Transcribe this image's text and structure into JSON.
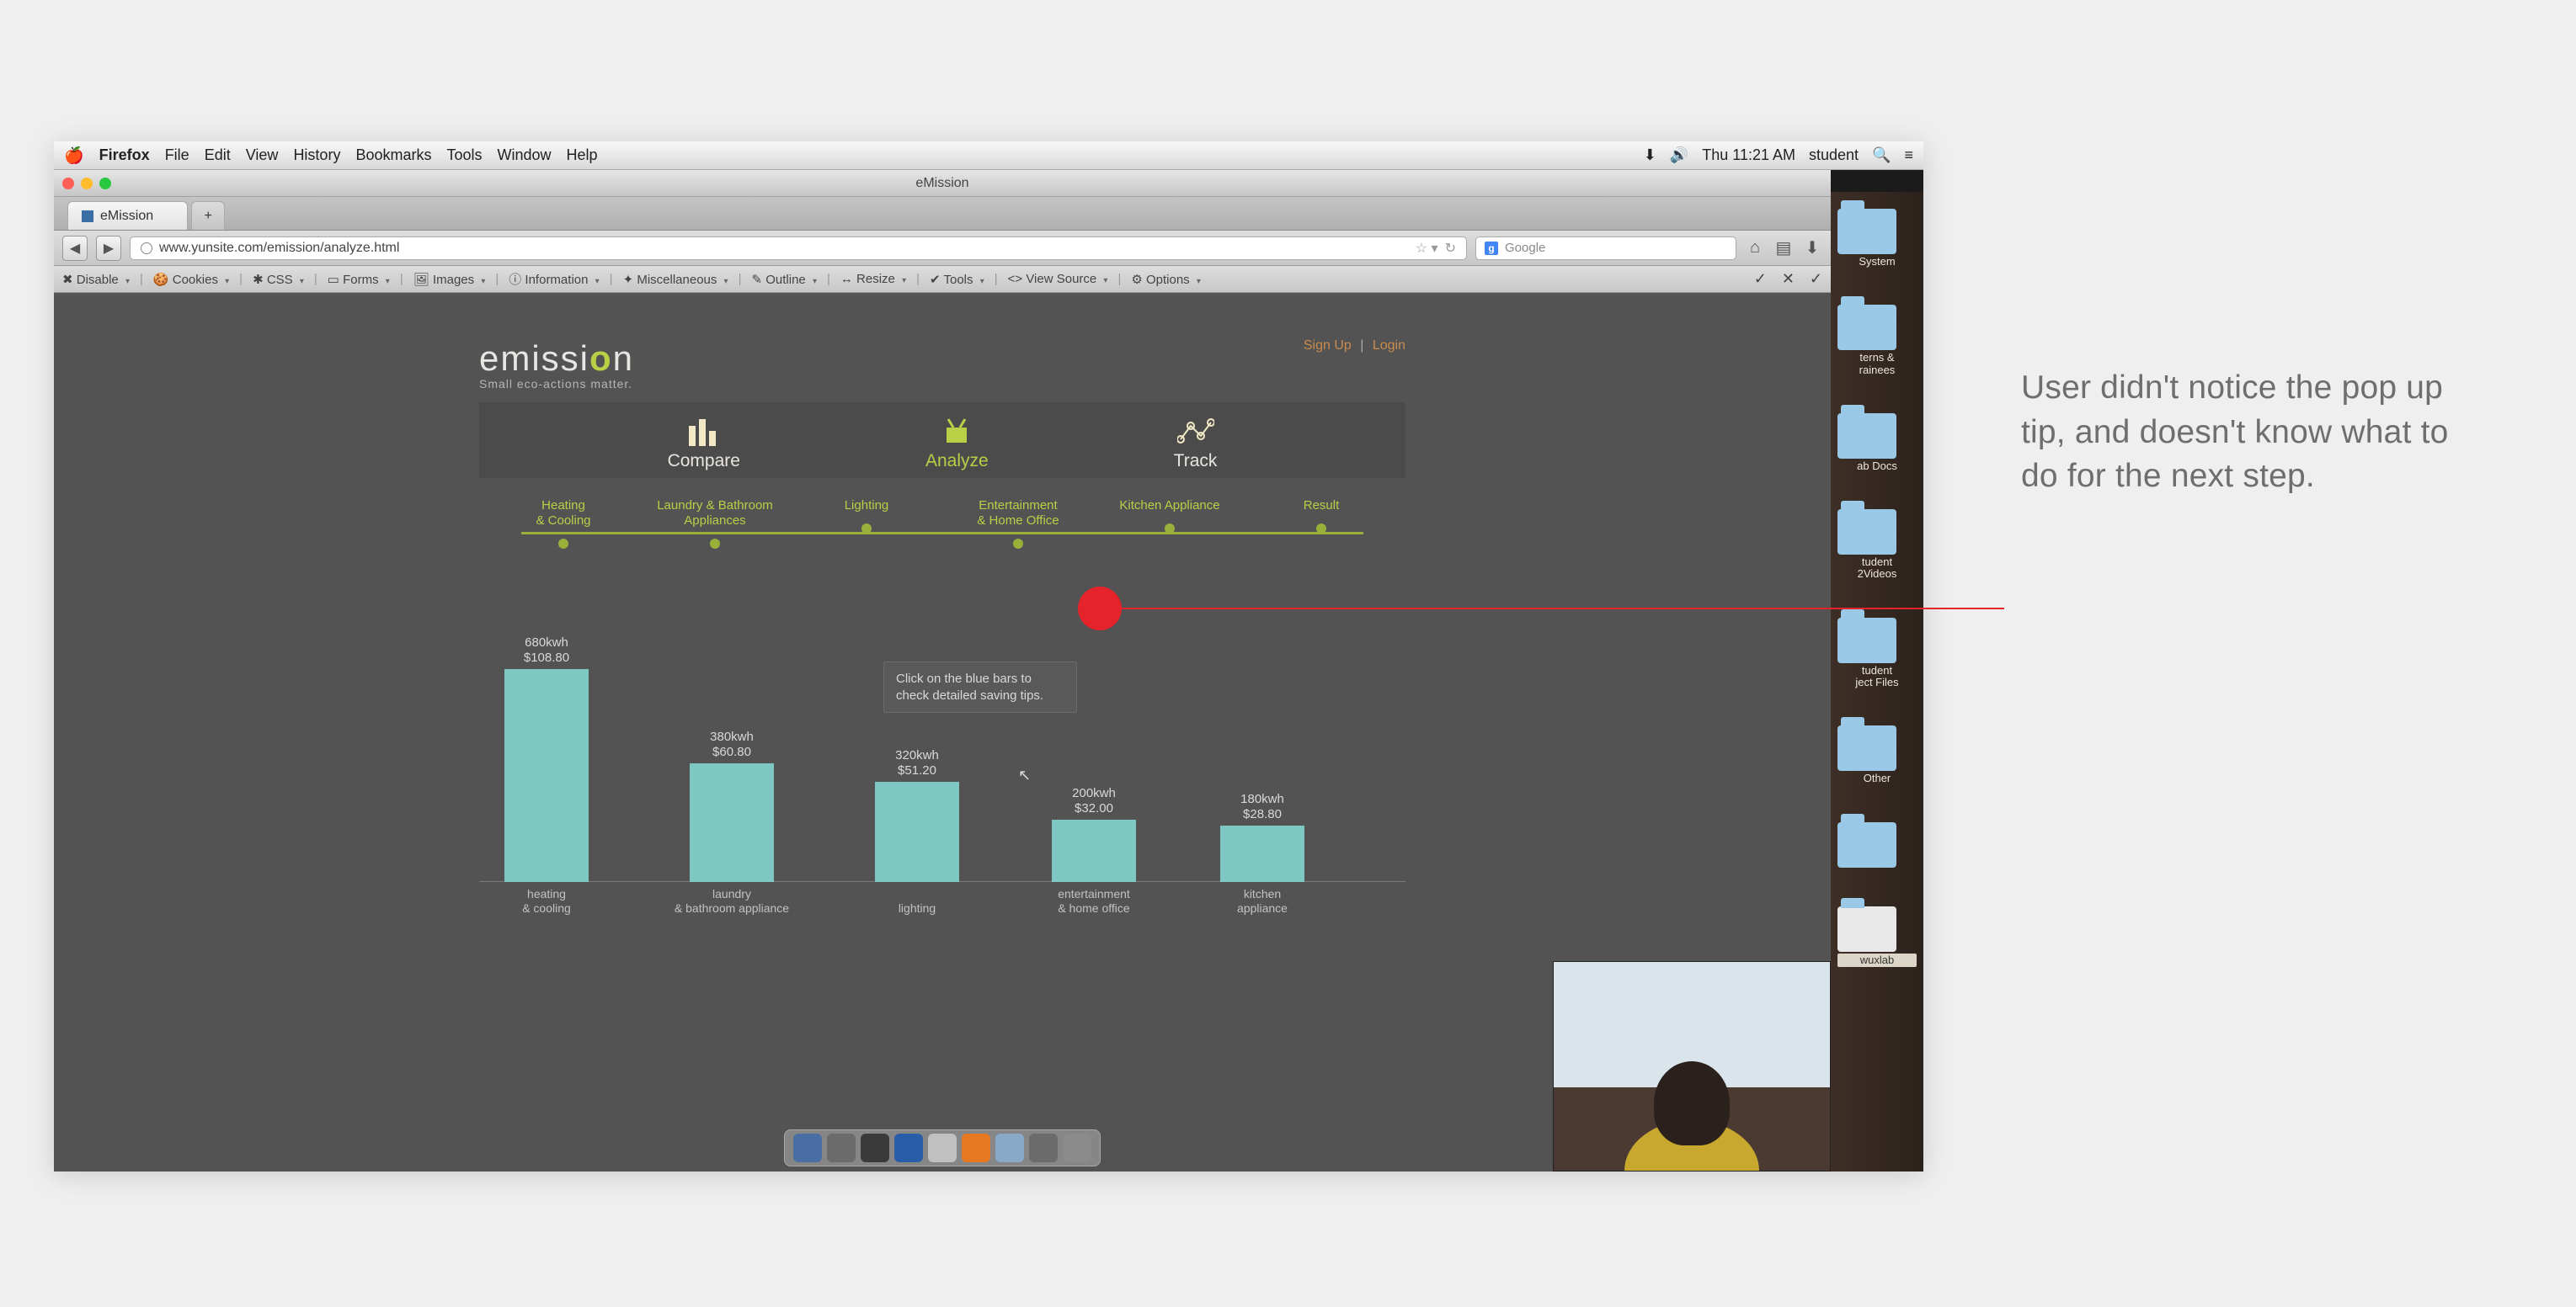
{
  "mac_menu": {
    "app": "Firefox",
    "items": [
      "File",
      "Edit",
      "View",
      "History",
      "Bookmarks",
      "Tools",
      "Window",
      "Help"
    ],
    "clock": "Thu 11:21 AM",
    "user": "student"
  },
  "window_title": "eMission",
  "tab_title": "eMission",
  "url": "www.yunsite.com/emission/analyze.html",
  "search_placeholder": "Google",
  "dev_toolbar": [
    "Disable",
    "Cookies",
    "CSS",
    "Forms",
    "Images",
    "Information",
    "Miscellaneous",
    "Outline",
    "Resize",
    "Tools",
    "View Source",
    "Options"
  ],
  "brand": {
    "logo_pre": "emissi",
    "logo_o": "o",
    "logo_post": "n",
    "tagline": "Small eco-actions matter."
  },
  "auth": {
    "signup": "Sign Up",
    "login": "Login"
  },
  "nav_tabs": [
    {
      "label": "Compare",
      "active": false
    },
    {
      "label": "Analyze",
      "active": true
    },
    {
      "label": "Track",
      "active": false
    }
  ],
  "progress": [
    {
      "label": "Heating\n& Cooling"
    },
    {
      "label": "Laundry & Bathroom\nAppliances"
    },
    {
      "label": "Lighting"
    },
    {
      "label": "Entertainment\n& Home Office"
    },
    {
      "label": "Kitchen Appliance"
    },
    {
      "label": "Result"
    }
  ],
  "tooltip": "Click on the blue bars to check detailed saving tips.",
  "chart_data": {
    "type": "bar",
    "title": "",
    "xlabel": "",
    "ylabel": "",
    "ylim": [
      0,
      700
    ],
    "categories": [
      "heating\n& cooling",
      "laundry\n& bathroom appliance",
      "lighting",
      "entertainment\n& home office",
      "kitchen\nappliance"
    ],
    "series": [
      {
        "name": "kwh",
        "values": [
          680,
          380,
          320,
          200,
          180
        ]
      },
      {
        "name": "usd",
        "values": [
          108.8,
          60.8,
          51.2,
          32.0,
          28.8
        ]
      }
    ],
    "bar_color": "#7ec8c4"
  },
  "desktop_folders": [
    "System",
    "terns &\nrainees",
    "ab Docs",
    "tudent\n2Videos",
    "tudent\nject Files",
    "Other",
    "",
    "wuxlab"
  ],
  "annotation_text": "User didn't notice the pop up tip, and doesn't know what to do for the next step."
}
